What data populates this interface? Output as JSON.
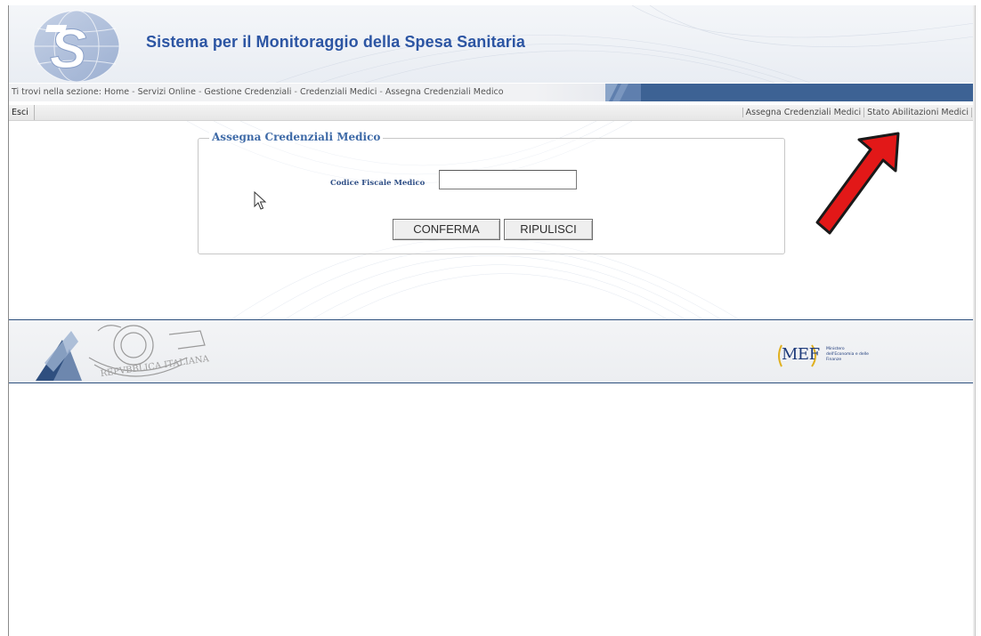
{
  "header": {
    "app_title": "Sistema per il Monitoraggio della Spesa Sanitaria",
    "logo_icon": "ts-logo-icon"
  },
  "breadcrumb": {
    "prefix": "Ti trovi nella sezione:",
    "items": [
      "Home",
      "Servizi Online",
      "Gestione Credenziali",
      "Credenziali Medici",
      "Assegna Credenziali Medico"
    ],
    "separator": "-"
  },
  "menu": {
    "left": {
      "esci_label": "Esci"
    },
    "right": [
      {
        "label": "Assegna Credenziali Medici"
      },
      {
        "label": "Stato Abilitazioni Medici"
      }
    ]
  },
  "form": {
    "legend": "Assegna Credenziali Medico",
    "codice_fiscale": {
      "label": "Codice Fiscale Medico",
      "value": ""
    },
    "buttons": {
      "confirm_label": "CONFERMA",
      "reset_label": "RIPULISCI"
    }
  },
  "footer": {
    "emblem_icon": "repubblica-italiana-emblem-icon",
    "mef": {
      "logo_text": "MEF",
      "caption": "Ministero dell'Economia e delle Finanze"
    }
  },
  "annotations": {
    "arrow_icon": "red-arrow-icon",
    "arrow_color": "#e21818"
  },
  "colors": {
    "title_blue": "#2c55a3",
    "bar_blue": "#3d6294",
    "legend_blue": "#3e6aa7"
  }
}
